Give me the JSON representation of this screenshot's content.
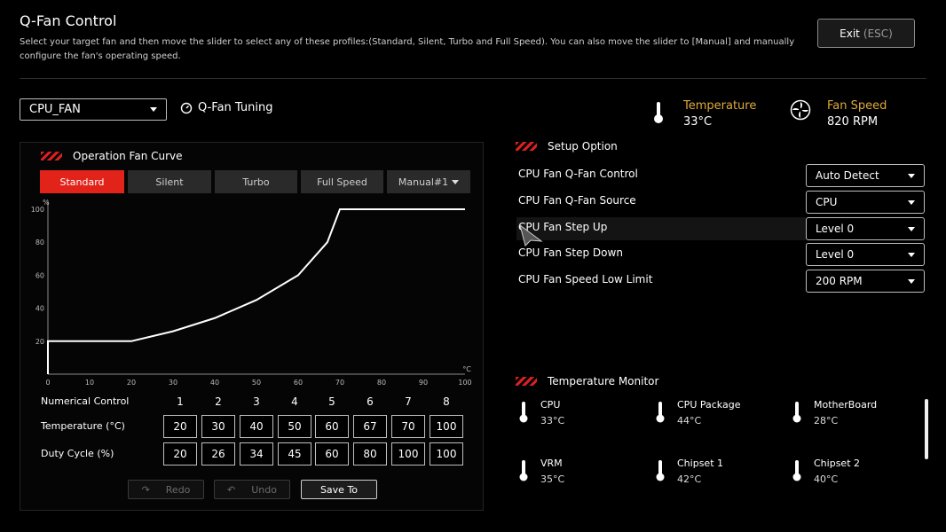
{
  "header": {
    "title": "Q-Fan Control",
    "description": "Select your target fan and then move the slider to select any of these profiles:(Standard, Silent, Turbo and Full Speed). You can also move the slider to [Manual] and manually configure the fan's operating speed.",
    "exit_label": "Exit",
    "exit_hint": "(ESC)"
  },
  "fan_select": {
    "value": "CPU_FAN"
  },
  "tuning_label": "Q-Fan Tuning",
  "stats": {
    "temperature_label": "Temperature",
    "temperature_value": "33°C",
    "fan_speed_label": "Fan Speed",
    "fan_speed_value": "820 RPM"
  },
  "curve_panel": {
    "title": "Operation Fan Curve",
    "tabs": [
      "Standard",
      "Silent",
      "Turbo",
      "Full Speed",
      "Manual#1"
    ],
    "active_tab": 0,
    "y_unit": "%",
    "x_unit": "°C"
  },
  "chart_data": {
    "type": "line",
    "title": "",
    "xlabel": "°C",
    "ylabel": "%",
    "xlim": [
      0,
      100
    ],
    "ylim": [
      0,
      100
    ],
    "x_ticks": [
      0,
      10,
      20,
      30,
      40,
      50,
      60,
      70,
      80,
      90,
      100
    ],
    "y_ticks": [
      20,
      40,
      60,
      80,
      100
    ],
    "x": [
      0,
      0,
      20,
      30,
      40,
      50,
      60,
      67,
      70,
      100
    ],
    "y": [
      0,
      20,
      20,
      26,
      34,
      45,
      60,
      80,
      100,
      100
    ],
    "grid": false
  },
  "grid": {
    "row_labels": [
      "Numerical Control",
      "Temperature (°C)",
      "Duty Cycle (%)"
    ],
    "numerical": [
      "1",
      "2",
      "3",
      "4",
      "5",
      "6",
      "7",
      "8"
    ],
    "temperature": [
      "20",
      "30",
      "40",
      "50",
      "60",
      "67",
      "70",
      "100"
    ],
    "duty": [
      "20",
      "26",
      "34",
      "45",
      "60",
      "80",
      "100",
      "100"
    ]
  },
  "actions": {
    "redo": "Redo",
    "undo": "Undo",
    "save": "Save To"
  },
  "setup": {
    "title": "Setup Option",
    "rows": [
      {
        "label": "CPU Fan Q-Fan Control",
        "value": "Auto Detect"
      },
      {
        "label": "CPU Fan Q-Fan Source",
        "value": "CPU"
      },
      {
        "label": "CPU Fan Step Up",
        "value": "Level 0"
      },
      {
        "label": "CPU Fan Step Down",
        "value": "Level 0"
      },
      {
        "label": "CPU Fan Speed Low Limit",
        "value": "200 RPM"
      }
    ]
  },
  "temp_monitor": {
    "title": "Temperature Monitor",
    "items": [
      {
        "name": "CPU",
        "value": "33°C"
      },
      {
        "name": "CPU Package",
        "value": "44°C"
      },
      {
        "name": "MotherBoard",
        "value": "28°C"
      },
      {
        "name": "VRM",
        "value": "35°C"
      },
      {
        "name": "Chipset 1",
        "value": "42°C"
      },
      {
        "name": "Chipset 2",
        "value": "40°C"
      }
    ]
  },
  "colors": {
    "accent": "#e2231a",
    "stat_label": "#e0a93a"
  }
}
